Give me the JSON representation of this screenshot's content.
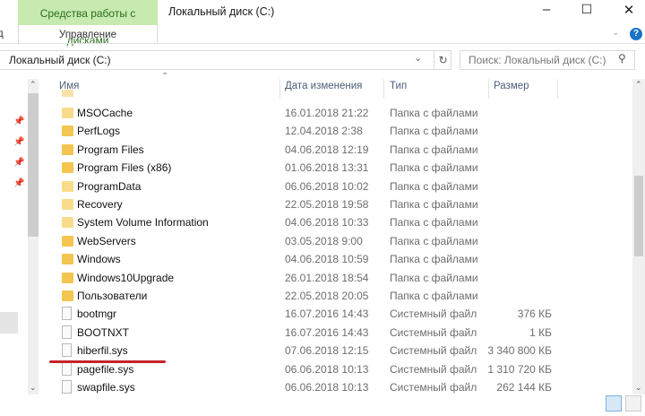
{
  "window": {
    "title": "Локальный диск (C:)",
    "contextual_tab": "Средства работы с дисками",
    "contextual_subtab": "Управление",
    "left_fragment": "д"
  },
  "address": {
    "path": "Локальный диск (C:)",
    "search_placeholder": "Поиск: Локальный диск (C:)"
  },
  "columns": {
    "name": "Имя",
    "date": "Дата изменения",
    "type": "Тип",
    "size": "Размер"
  },
  "files": [
    {
      "name": "MSOCache",
      "date": "16.01.2018 21:22",
      "type": "Папка с файлами",
      "size": "",
      "kind": "folder-light"
    },
    {
      "name": "PerfLogs",
      "date": "12.04.2018 2:38",
      "type": "Папка с файлами",
      "size": "",
      "kind": "folder"
    },
    {
      "name": "Program Files",
      "date": "04.06.2018 12:19",
      "type": "Папка с файлами",
      "size": "",
      "kind": "folder"
    },
    {
      "name": "Program Files (x86)",
      "date": "01.06.2018 13:31",
      "type": "Папка с файлами",
      "size": "",
      "kind": "folder"
    },
    {
      "name": "ProgramData",
      "date": "06.06.2018 10:02",
      "type": "Папка с файлами",
      "size": "",
      "kind": "folder-light"
    },
    {
      "name": "Recovery",
      "date": "22.05.2018 19:58",
      "type": "Папка с файлами",
      "size": "",
      "kind": "folder-light"
    },
    {
      "name": "System Volume Information",
      "date": "04.06.2018 10:33",
      "type": "Папка с файлами",
      "size": "",
      "kind": "folder-light"
    },
    {
      "name": "WebServers",
      "date": "03.05.2018 9:00",
      "type": "Папка с файлами",
      "size": "",
      "kind": "folder"
    },
    {
      "name": "Windows",
      "date": "04.06.2018 10:59",
      "type": "Папка с файлами",
      "size": "",
      "kind": "folder"
    },
    {
      "name": "Windows10Upgrade",
      "date": "26.01.2018 18:54",
      "type": "Папка с файлами",
      "size": "",
      "kind": "folder"
    },
    {
      "name": "Пользователи",
      "date": "22.05.2018 20:05",
      "type": "Папка с файлами",
      "size": "",
      "kind": "folder"
    },
    {
      "name": "bootmgr",
      "date": "16.07.2016 14:43",
      "type": "Системный файл",
      "size": "376 КБ",
      "kind": "file"
    },
    {
      "name": "BOOTNXT",
      "date": "16.07.2016 14:43",
      "type": "Системный файл",
      "size": "1 КБ",
      "kind": "file"
    },
    {
      "name": "hiberfil.sys",
      "date": "07.06.2018 12:15",
      "type": "Системный файл",
      "size": "3 340 800 КБ",
      "kind": "file"
    },
    {
      "name": "pagefile.sys",
      "date": "06.06.2018 10:13",
      "type": "Системный файл",
      "size": "1 310 720 КБ",
      "kind": "file"
    },
    {
      "name": "swapfile.sys",
      "date": "06.06.2018 10:13",
      "type": "Системный файл",
      "size": "262 144 КБ",
      "kind": "file"
    }
  ],
  "highlight_color": "#c4232a"
}
